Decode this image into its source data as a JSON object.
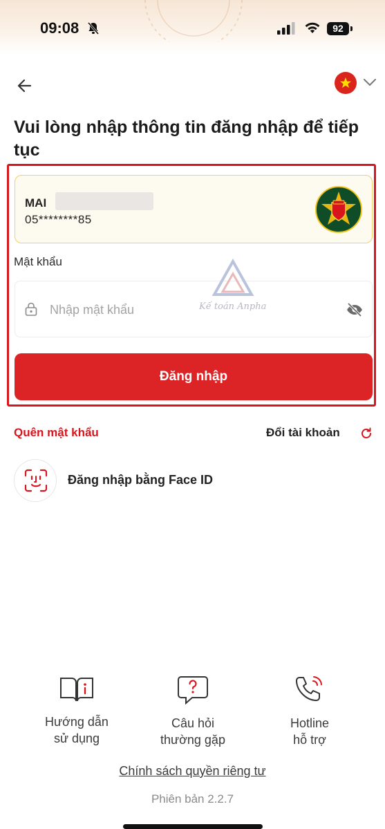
{
  "status_bar": {
    "time": "09:08",
    "battery": "92"
  },
  "header": {
    "language": "Tiếng Việt"
  },
  "title": "Vui lòng nhập thông tin đăng nhập để tiếp tục",
  "account": {
    "name": "MAI",
    "phone": "05********85"
  },
  "password": {
    "label": "Mật khẩu",
    "placeholder": "Nhập mật khẩu",
    "value": ""
  },
  "watermark": {
    "text": "Kế toán Anpha"
  },
  "login_button": "Đăng nhập",
  "links": {
    "forgot": "Quên mật khẩu",
    "switch_account": "Đổi tài khoản"
  },
  "face_id": {
    "label": "Đăng nhập bằng Face ID"
  },
  "bottom_menu": [
    {
      "line1": "Hướng dẫn",
      "line2": "sử dụng",
      "icon": "book-icon"
    },
    {
      "line1": "Câu hỏi",
      "line2": "thường gặp",
      "icon": "faq-icon"
    },
    {
      "line1": "Hotline",
      "line2": "hỗ trợ",
      "icon": "phone-icon"
    }
  ],
  "privacy": "Chính sách quyền riêng tư",
  "version": "Phiên bản 2.2.7",
  "colors": {
    "accent": "#dc2426",
    "card_border": "#efd16b",
    "card_bg": "#fdfaef"
  }
}
